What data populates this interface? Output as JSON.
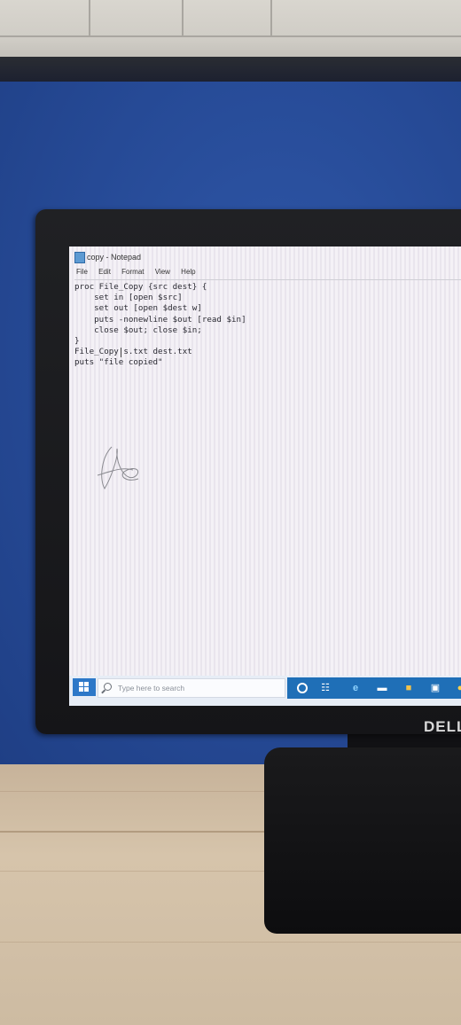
{
  "window": {
    "title": "copy - Notepad"
  },
  "menu": [
    "File",
    "Edit",
    "Format",
    "View",
    "Help"
  ],
  "editor": {
    "lines": [
      "proc File_Copy {src dest} {",
      "    set in [open $src]",
      "    set out [open $dest w]",
      "    puts -nonewline $out [read $in]",
      "    close $out; close $in;",
      "}",
      "File_Copy s.txt dest.txt",
      "puts \"file copied\""
    ]
  },
  "taskbar": {
    "search_placeholder": "Type here to search",
    "icons": [
      "windows-start-icon",
      "cortana-icon",
      "task-view-icon",
      "edge-icon",
      "store-icon",
      "file-explorer-icon",
      "calendar-icon",
      "chrome-icon"
    ]
  },
  "monitor": {
    "brand": "DELL"
  },
  "colors": {
    "cubicle_blue": "#264a96",
    "taskbar_blue": "#1f6fb7",
    "desk_wood": "#d6c4ab"
  }
}
